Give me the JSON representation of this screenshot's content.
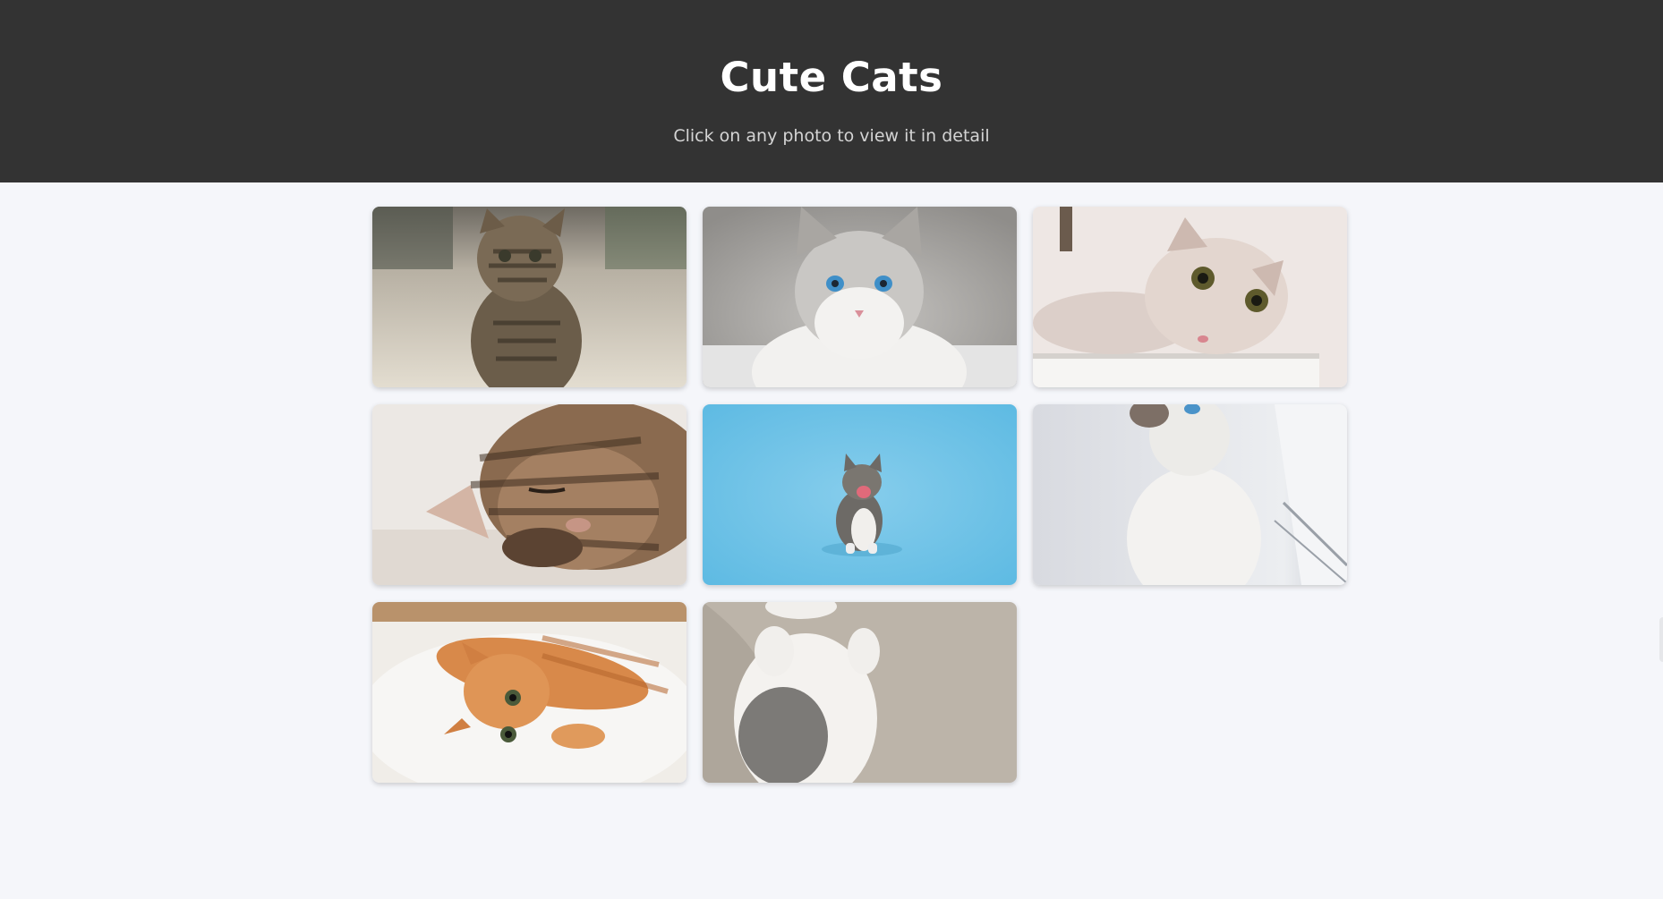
{
  "header": {
    "title": "Cute Cats",
    "subtitle": "Click on any photo to view it in detail"
  },
  "gallery": {
    "photos": [
      {
        "subject": "tabby kitten sitting on carpet",
        "bg": "#cfc6b6"
      },
      {
        "subject": "fluffy grey and white cat with blue eyes",
        "bg": "#b9b7b4"
      },
      {
        "subject": "cream cat with folded ears peeking over edge",
        "bg": "#e8e0dd"
      },
      {
        "subject": "tabby kitten sleeping on blanket",
        "bg": "#e9e4df"
      },
      {
        "subject": "small kitten meowing on blue background",
        "bg": "#6cc3e6"
      },
      {
        "subject": "white siamese kitten looking up by window",
        "bg": "#e7e8ec"
      },
      {
        "subject": "orange kitten lying on white rug",
        "bg": "#d9d3cc"
      },
      {
        "subject": "grey and white kitten on its back",
        "bg": "#b8b0a6"
      }
    ]
  },
  "colors": {
    "header_bg": "#333333",
    "page_bg": "#f5f6fa",
    "title": "#ffffff",
    "subtitle": "#d4d4d4"
  }
}
